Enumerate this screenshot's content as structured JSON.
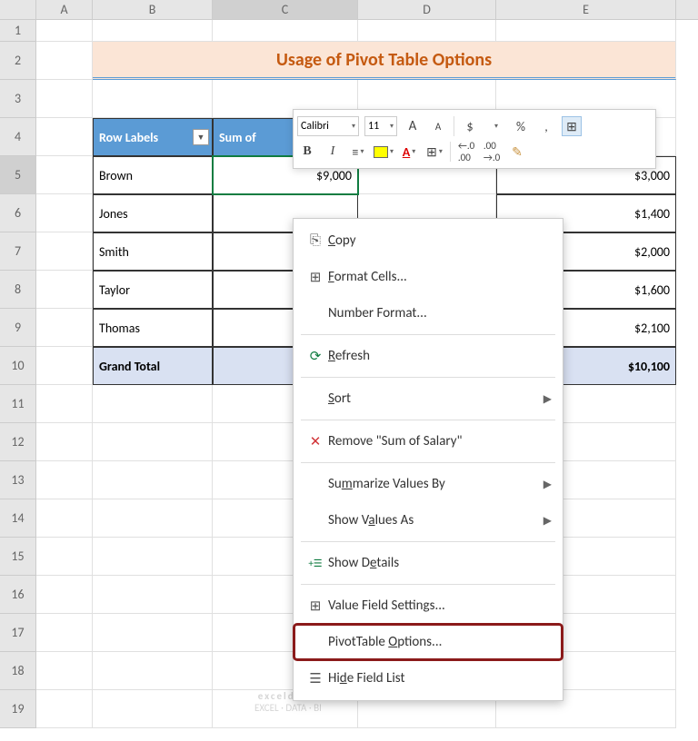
{
  "columns": [
    "A",
    "B",
    "C",
    "D",
    "E"
  ],
  "rows": [
    "1",
    "2",
    "3",
    "4",
    "5",
    "6",
    "7",
    "8",
    "9",
    "10",
    "11",
    "12",
    "13",
    "14",
    "15",
    "16",
    "17",
    "18",
    "19"
  ],
  "active_col": "C",
  "active_row": "5",
  "title": "Usage of Pivot Table Options",
  "pivot": {
    "headers": {
      "row_labels": "Row Labels",
      "sumof": "Sum of"
    },
    "data": [
      {
        "label": "Brown",
        "c": "$9,000",
        "e": "$3,000"
      },
      {
        "label": "Jones",
        "c": "",
        "e": "$1,400"
      },
      {
        "label": "Smith",
        "c": "",
        "e": "$2,000"
      },
      {
        "label": "Taylor",
        "c": "",
        "e": "$1,600"
      },
      {
        "label": "Thomas",
        "c": "",
        "e": "$2,100"
      }
    ],
    "total": {
      "label": "Grand Total",
      "c": "$",
      "e": "$10,100"
    }
  },
  "mini_toolbar": {
    "font": "Calibri",
    "size": "11",
    "tools": {
      "inc": "A",
      "dec": "A",
      "dollar": "$",
      "percent": "%",
      "comma": ",",
      "bold": "B",
      "italic": "I"
    }
  },
  "context_menu": {
    "copy": "Copy",
    "format_cells": "Format Cells...",
    "number_format": "Number Format...",
    "refresh": "Refresh",
    "sort": "Sort",
    "remove": "Remove \"Sum of Salary\"",
    "summarize": "Summarize Values By",
    "show_values": "Show Values As",
    "show_details": "Show Details",
    "value_field": "Value Field Settings...",
    "pivot_options": "PivotTable Options...",
    "hide_field": "Hide Field List"
  },
  "watermark": {
    "line1": "exceldemy",
    "line2": "EXCEL · DATA · BI"
  }
}
